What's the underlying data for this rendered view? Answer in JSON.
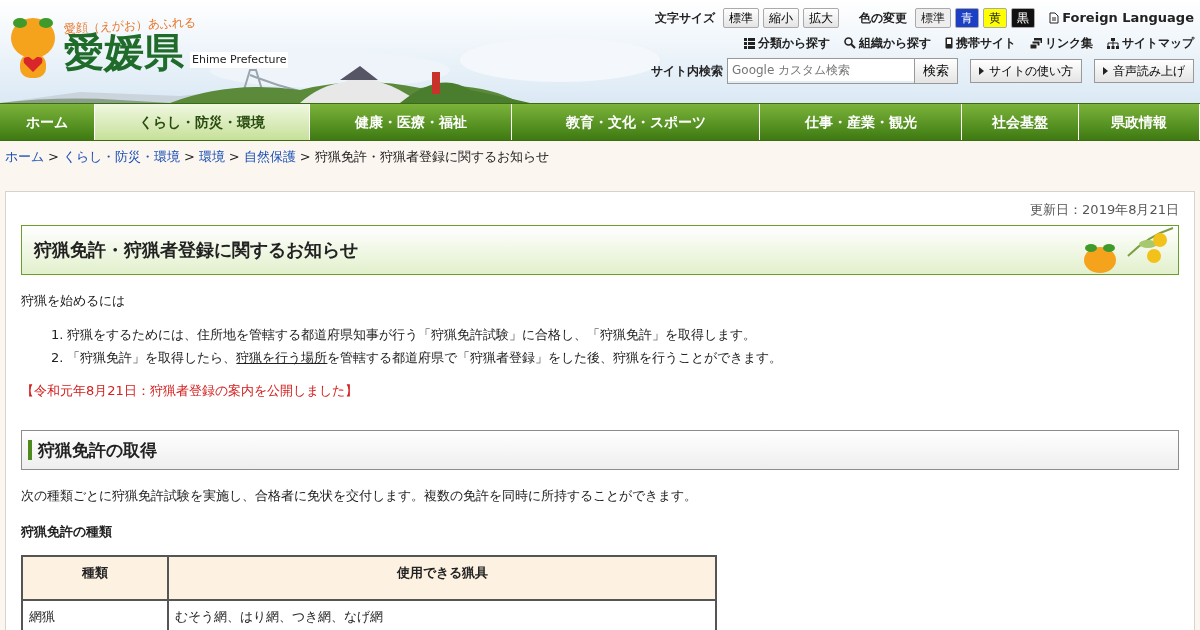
{
  "header": {
    "tagline": "愛顔（えがお）あふれる",
    "logo": "愛媛県",
    "logo_en": "Ehime Prefecture",
    "font_size": {
      "label": "文字サイズ",
      "buttons": [
        "標準",
        "縮小",
        "拡大"
      ]
    },
    "color_change": {
      "label": "色の変更",
      "buttons": [
        {
          "label": "標準",
          "color": "#eeeeee"
        },
        {
          "label": "青",
          "color": "#1c3fc4"
        },
        {
          "label": "黄",
          "color": "#ffff00"
        },
        {
          "label": "黒",
          "color": "#111111"
        }
      ]
    },
    "foreign_language": "Foreign Language",
    "links": [
      "分類から探す",
      "組織から探す",
      "携帯サイト",
      "リンク集",
      "サイトマップ"
    ],
    "search": {
      "label": "サイト内検索",
      "placeholder": "Google カスタム検索",
      "button": "検索"
    },
    "guides": [
      "サイトの使い方",
      "音声読み上げ"
    ]
  },
  "nav": [
    {
      "label": "ホーム",
      "selected": false
    },
    {
      "label": "くらし・防災・環境",
      "selected": true
    },
    {
      "label": "健康・医療・福祉",
      "selected": false
    },
    {
      "label": "教育・文化・スポーツ",
      "selected": false
    },
    {
      "label": "仕事・産業・観光",
      "selected": false
    },
    {
      "label": "社会基盤",
      "selected": false
    },
    {
      "label": "県政情報",
      "selected": false
    }
  ],
  "breadcrumb": {
    "separator": ">",
    "links": [
      "ホーム",
      "くらし・防災・環境",
      "環境",
      "自然保護"
    ],
    "current": "狩猟免許・狩猟者登録に関するお知らせ"
  },
  "updated": "更新日：2019年8月21日",
  "title": "狩猟免許・狩猟者登録に関するお知らせ",
  "intro": "狩猟を始めるには",
  "steps": [
    {
      "number": "1.",
      "parts": [
        {
          "text": "狩猟をするためには、住所地を管轄する都道府県知事が行う「狩猟免許試験」に合格し、「狩猟免許」を取得します。",
          "kind": "text"
        }
      ]
    },
    {
      "number": "2.",
      "parts": [
        {
          "text": "「狩猟免許」を取得したら、",
          "kind": "text"
        },
        {
          "text": "狩猟を行う場所",
          "kind": "link"
        },
        {
          "text": "を管轄する都道府県で「狩猟者登録」をした後、狩猟を行うことができます。",
          "kind": "text"
        }
      ]
    }
  ],
  "notice": "【令和元年8月21日：狩猟者登録の案内を公開しました】",
  "section": {
    "heading": "狩猟免許の取得",
    "text": "次の種類ごとに狩猟免許試験を実施し、合格者に免状を交付します。複数の免許を同時に所持することができます。",
    "subheading": "狩猟免許の種類",
    "table": {
      "columns": [
        "種類",
        "使用できる猟具"
      ],
      "rows": [
        [
          "網猟",
          "むそう網、はり網、つき網、なげ網"
        ]
      ]
    }
  }
}
